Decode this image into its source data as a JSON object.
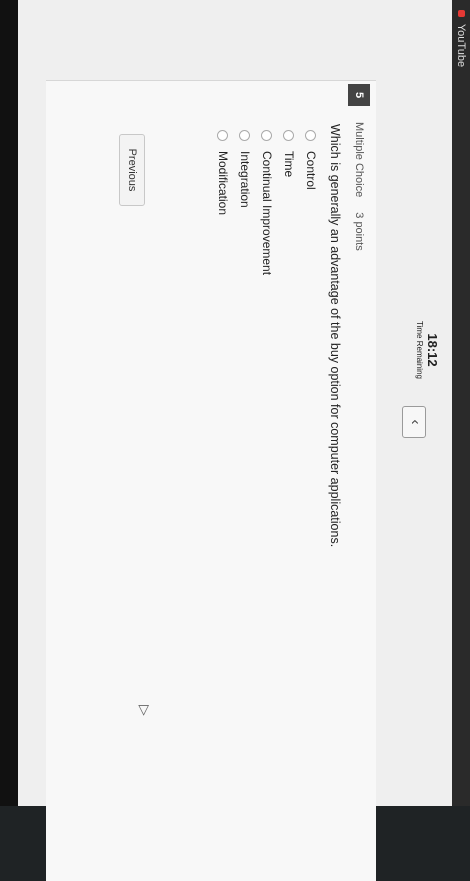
{
  "browser": {
    "tab_label": "YouTube"
  },
  "header": {
    "timer_value": "18:12",
    "timer_label": "Time Remaining",
    "back_icon": "chevron-left-icon"
  },
  "question": {
    "number": "5",
    "type": "Multiple Choice",
    "points": "3 points",
    "text": "Which is generally an advantage of the buy option for computer applications.",
    "options": [
      {
        "label": "Control"
      },
      {
        "label": "Time"
      },
      {
        "label": "Continual Improvement"
      },
      {
        "label": "Integration"
      },
      {
        "label": "Modification"
      }
    ]
  },
  "footer": {
    "previous_label": "Previous"
  },
  "colors": {
    "page_bg": "#efefef",
    "badge_bg": "#444444",
    "card_bg": "#f8f8f8"
  }
}
